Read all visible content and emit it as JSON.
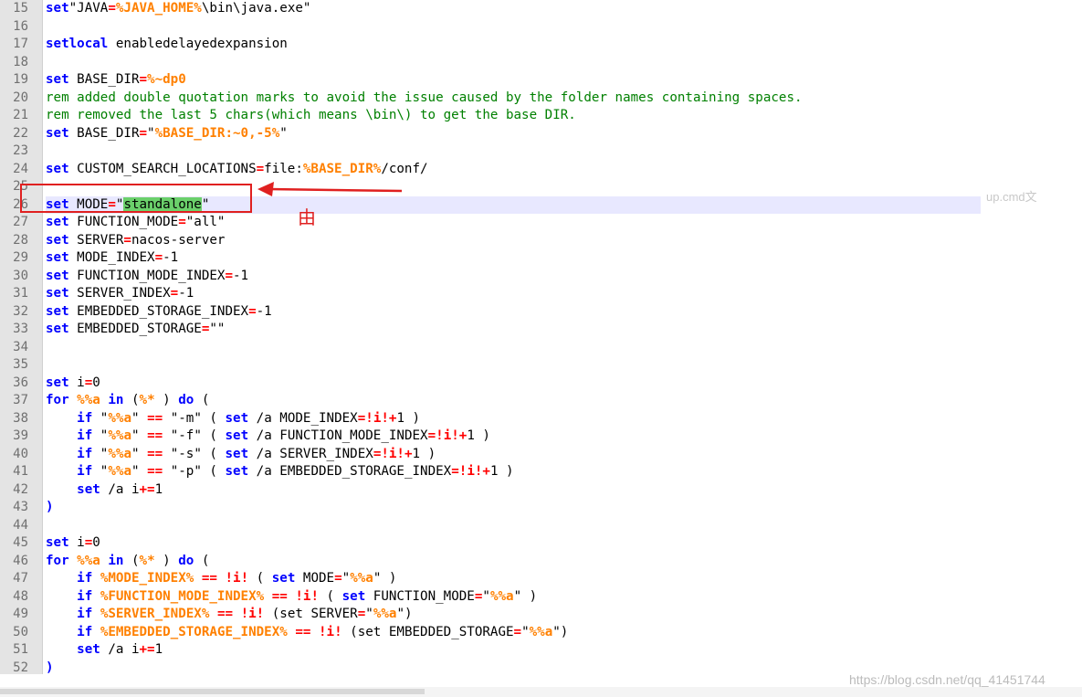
{
  "watermarks": {
    "top_right": "up.cmd文",
    "bottom_right": "https://blog.csdn.net/qq_41451744"
  },
  "annotation": {
    "label": "由"
  },
  "colors": {
    "keyword": "#0000ff",
    "operator": "#ff0000",
    "variable": "#ff8000",
    "comment": "#008000",
    "highlight": "#6bd06b",
    "annotation": "#e02020"
  },
  "lines": [
    {
      "n": "15",
      "t": [
        [
          "kw",
          "set"
        ],
        [
          "",
          "\"JAVA"
        ],
        [
          "op",
          "="
        ],
        [
          "var",
          "%JAVA_HOME%"
        ],
        [
          "",
          "\\bin\\java.exe\""
        ]
      ]
    },
    {
      "n": "16",
      "t": []
    },
    {
      "n": "17",
      "t": [
        [
          "kw",
          "setlocal"
        ],
        [
          "",
          " enabledelayedexpansion"
        ]
      ]
    },
    {
      "n": "18",
      "t": []
    },
    {
      "n": "19",
      "t": [
        [
          "kw",
          "set"
        ],
        [
          "",
          " BASE_DIR"
        ],
        [
          "op",
          "="
        ],
        [
          "var",
          "%~dp0"
        ]
      ]
    },
    {
      "n": "20",
      "t": [
        [
          "rem",
          "rem added double quotation marks to avoid the issue caused by the folder names containing spaces."
        ]
      ]
    },
    {
      "n": "21",
      "t": [
        [
          "rem",
          "rem removed the last 5 chars(which means \\bin\\) to get the base DIR."
        ]
      ]
    },
    {
      "n": "22",
      "t": [
        [
          "kw",
          "set"
        ],
        [
          "",
          " BASE_DIR"
        ],
        [
          "op",
          "="
        ],
        [
          "",
          "\""
        ],
        [
          "var",
          "%BASE_DIR:~0,-5%"
        ],
        [
          "",
          "\""
        ]
      ]
    },
    {
      "n": "23",
      "t": []
    },
    {
      "n": "24",
      "t": [
        [
          "kw",
          "set"
        ],
        [
          "",
          " CUSTOM_SEARCH_LOCATIONS"
        ],
        [
          "op",
          "="
        ],
        [
          "",
          "file:"
        ],
        [
          "var",
          "%BASE_DIR%"
        ],
        [
          "",
          "/conf/"
        ]
      ]
    },
    {
      "n": "25",
      "t": []
    },
    {
      "n": "26",
      "t": [
        [
          "kw",
          "set"
        ],
        [
          "",
          " MODE"
        ],
        [
          "op",
          "="
        ],
        [
          "",
          "\""
        ],
        [
          "hl",
          "standalone"
        ],
        [
          "",
          "\""
        ]
      ],
      "current": true
    },
    {
      "n": "27",
      "t": [
        [
          "kw",
          "set"
        ],
        [
          "",
          " FUNCTION_MODE"
        ],
        [
          "op",
          "="
        ],
        [
          "",
          "\"all\""
        ]
      ]
    },
    {
      "n": "28",
      "t": [
        [
          "kw",
          "set"
        ],
        [
          "",
          " SERVER"
        ],
        [
          "op",
          "="
        ],
        [
          "",
          "nacos-server"
        ]
      ]
    },
    {
      "n": "29",
      "t": [
        [
          "kw",
          "set"
        ],
        [
          "",
          " MODE_INDEX"
        ],
        [
          "op",
          "="
        ],
        [
          "",
          "-1"
        ]
      ]
    },
    {
      "n": "30",
      "t": [
        [
          "kw",
          "set"
        ],
        [
          "",
          " FUNCTION_MODE_INDEX"
        ],
        [
          "op",
          "="
        ],
        [
          "",
          "-1"
        ]
      ]
    },
    {
      "n": "31",
      "t": [
        [
          "kw",
          "set"
        ],
        [
          "",
          " SERVER_INDEX"
        ],
        [
          "op",
          "="
        ],
        [
          "",
          "-1"
        ]
      ]
    },
    {
      "n": "32",
      "t": [
        [
          "kw",
          "set"
        ],
        [
          "",
          " EMBEDDED_STORAGE_INDEX"
        ],
        [
          "op",
          "="
        ],
        [
          "",
          "-1"
        ]
      ]
    },
    {
      "n": "33",
      "t": [
        [
          "kw",
          "set"
        ],
        [
          "",
          " EMBEDDED_STORAGE"
        ],
        [
          "op",
          "="
        ],
        [
          "",
          "\"\""
        ]
      ]
    },
    {
      "n": "34",
      "t": []
    },
    {
      "n": "35",
      "t": []
    },
    {
      "n": "36",
      "t": [
        [
          "kw",
          "set"
        ],
        [
          "",
          " i"
        ],
        [
          "op",
          "="
        ],
        [
          "",
          "0"
        ]
      ]
    },
    {
      "n": "37",
      "t": [
        [
          "kw",
          "for"
        ],
        [
          "",
          " "
        ],
        [
          "var",
          "%%a"
        ],
        [
          "",
          " "
        ],
        [
          "kw",
          "in"
        ],
        [
          "",
          " ("
        ],
        [
          "var",
          "%*"
        ],
        [
          "",
          " ) "
        ],
        [
          "kw",
          "do"
        ],
        [
          "",
          " ("
        ]
      ]
    },
    {
      "n": "38",
      "t": [
        [
          "",
          "    "
        ],
        [
          "kw",
          "if"
        ],
        [
          "",
          " \""
        ],
        [
          "var",
          "%%a"
        ],
        [
          "",
          "\" "
        ],
        [
          "op",
          "=="
        ],
        [
          "",
          " \"-m\" ( "
        ],
        [
          "kw",
          "set"
        ],
        [
          "",
          " /a MODE_INDEX"
        ],
        [
          "op",
          "=!i!+"
        ],
        [
          "",
          "1 )"
        ]
      ]
    },
    {
      "n": "39",
      "t": [
        [
          "",
          "    "
        ],
        [
          "kw",
          "if"
        ],
        [
          "",
          " \""
        ],
        [
          "var",
          "%%a"
        ],
        [
          "",
          "\" "
        ],
        [
          "op",
          "=="
        ],
        [
          "",
          " \"-f\" ( "
        ],
        [
          "kw",
          "set"
        ],
        [
          "",
          " /a FUNCTION_MODE_INDEX"
        ],
        [
          "op",
          "=!i!+"
        ],
        [
          "",
          "1 )"
        ]
      ]
    },
    {
      "n": "40",
      "t": [
        [
          "",
          "    "
        ],
        [
          "kw",
          "if"
        ],
        [
          "",
          " \""
        ],
        [
          "var",
          "%%a"
        ],
        [
          "",
          "\" "
        ],
        [
          "op",
          "=="
        ],
        [
          "",
          " \"-s\" ( "
        ],
        [
          "kw",
          "set"
        ],
        [
          "",
          " /a SERVER_INDEX"
        ],
        [
          "op",
          "=!i!+"
        ],
        [
          "",
          "1 )"
        ]
      ]
    },
    {
      "n": "41",
      "t": [
        [
          "",
          "    "
        ],
        [
          "kw",
          "if"
        ],
        [
          "",
          " \""
        ],
        [
          "var",
          "%%a"
        ],
        [
          "",
          "\" "
        ],
        [
          "op",
          "=="
        ],
        [
          "",
          " \"-p\" ( "
        ],
        [
          "kw",
          "set"
        ],
        [
          "",
          " /a EMBEDDED_STORAGE_INDEX"
        ],
        [
          "op",
          "=!i!+"
        ],
        [
          "",
          "1 )"
        ]
      ]
    },
    {
      "n": "42",
      "t": [
        [
          "",
          "    "
        ],
        [
          "kw",
          "set"
        ],
        [
          "",
          " /a i"
        ],
        [
          "op",
          "+="
        ],
        [
          "",
          "1"
        ]
      ]
    },
    {
      "n": "43",
      "t": [
        [
          "kw",
          ")"
        ]
      ]
    },
    {
      "n": "44",
      "t": []
    },
    {
      "n": "45",
      "t": [
        [
          "kw",
          "set"
        ],
        [
          "",
          " i"
        ],
        [
          "op",
          "="
        ],
        [
          "",
          "0"
        ]
      ]
    },
    {
      "n": "46",
      "t": [
        [
          "kw",
          "for"
        ],
        [
          "",
          " "
        ],
        [
          "var",
          "%%a"
        ],
        [
          "",
          " "
        ],
        [
          "kw",
          "in"
        ],
        [
          "",
          " ("
        ],
        [
          "var",
          "%*"
        ],
        [
          "",
          " ) "
        ],
        [
          "kw",
          "do"
        ],
        [
          "",
          " ("
        ]
      ]
    },
    {
      "n": "47",
      "t": [
        [
          "",
          "    "
        ],
        [
          "kw",
          "if"
        ],
        [
          "",
          " "
        ],
        [
          "var",
          "%MODE_INDEX%"
        ],
        [
          "",
          " "
        ],
        [
          "op",
          "=="
        ],
        [
          "",
          " "
        ],
        [
          "op",
          "!i!"
        ],
        [
          "",
          " ( "
        ],
        [
          "kw",
          "set"
        ],
        [
          "",
          " MODE"
        ],
        [
          "op",
          "="
        ],
        [
          "",
          "\""
        ],
        [
          "var",
          "%%a"
        ],
        [
          "",
          "\" )"
        ]
      ]
    },
    {
      "n": "48",
      "t": [
        [
          "",
          "    "
        ],
        [
          "kw",
          "if"
        ],
        [
          "",
          " "
        ],
        [
          "var",
          "%FUNCTION_MODE_INDEX%"
        ],
        [
          "",
          " "
        ],
        [
          "op",
          "=="
        ],
        [
          "",
          " "
        ],
        [
          "op",
          "!i!"
        ],
        [
          "",
          " ( "
        ],
        [
          "kw",
          "set"
        ],
        [
          "",
          " FUNCTION_MODE"
        ],
        [
          "op",
          "="
        ],
        [
          "",
          "\""
        ],
        [
          "var",
          "%%a"
        ],
        [
          "",
          "\" )"
        ]
      ]
    },
    {
      "n": "49",
      "t": [
        [
          "",
          "    "
        ],
        [
          "kw",
          "if"
        ],
        [
          "",
          " "
        ],
        [
          "var",
          "%SERVER_INDEX%"
        ],
        [
          "",
          " "
        ],
        [
          "op",
          "=="
        ],
        [
          "",
          " "
        ],
        [
          "op",
          "!i!"
        ],
        [
          "",
          " (set SERVER"
        ],
        [
          "op",
          "="
        ],
        [
          "",
          "\""
        ],
        [
          "var",
          "%%a"
        ],
        [
          "",
          "\")"
        ]
      ]
    },
    {
      "n": "50",
      "t": [
        [
          "",
          "    "
        ],
        [
          "kw",
          "if"
        ],
        [
          "",
          " "
        ],
        [
          "var",
          "%EMBEDDED_STORAGE_INDEX%"
        ],
        [
          "",
          " "
        ],
        [
          "op",
          "=="
        ],
        [
          "",
          " "
        ],
        [
          "op",
          "!i!"
        ],
        [
          "",
          " (set EMBEDDED_STORAGE"
        ],
        [
          "op",
          "="
        ],
        [
          "",
          "\""
        ],
        [
          "var",
          "%%a"
        ],
        [
          "",
          "\")"
        ]
      ]
    },
    {
      "n": "51",
      "t": [
        [
          "",
          "    "
        ],
        [
          "kw",
          "set"
        ],
        [
          "",
          " /a i"
        ],
        [
          "op",
          "+="
        ],
        [
          "",
          "1"
        ]
      ]
    },
    {
      "n": "52",
      "t": [
        [
          "kw",
          ")"
        ]
      ]
    }
  ]
}
